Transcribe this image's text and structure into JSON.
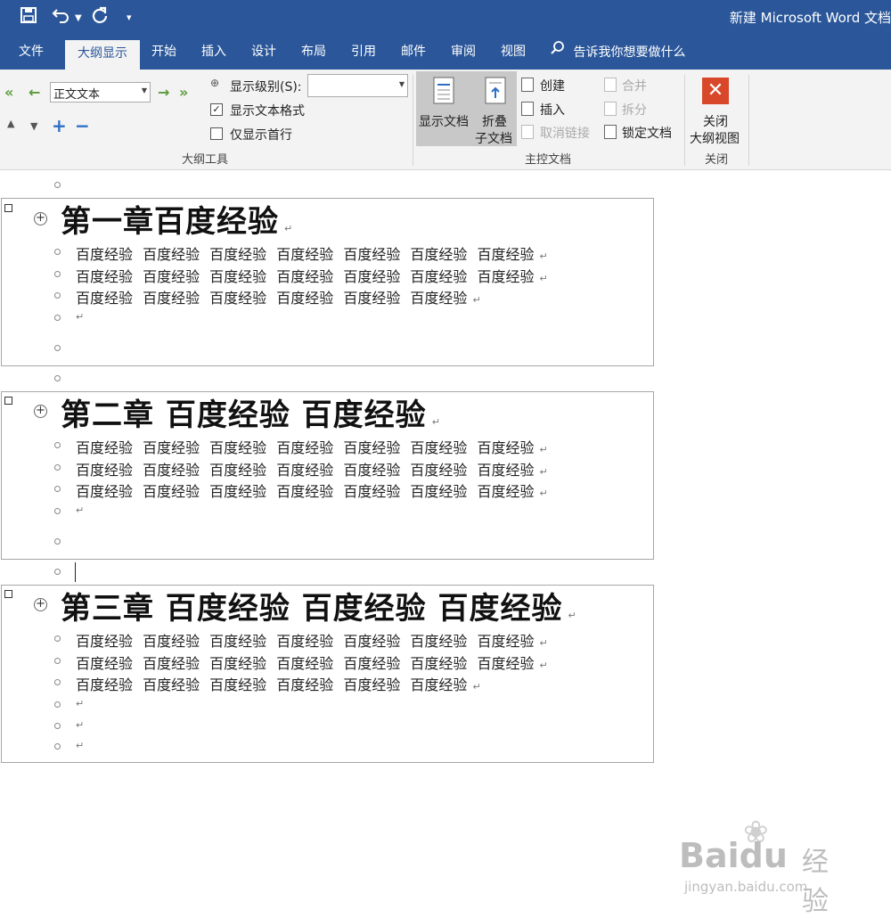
{
  "titlebar": {
    "doc_title": "新建 Microsoft Word 文档",
    "icons": [
      "save-icon",
      "undo-icon",
      "redo-icon",
      "customize-qat-icon"
    ]
  },
  "tabs": [
    {
      "label": "文件",
      "active": false
    },
    {
      "label": "大纲显示",
      "active": true
    },
    {
      "label": "开始",
      "active": false
    },
    {
      "label": "插入",
      "active": false
    },
    {
      "label": "设计",
      "active": false
    },
    {
      "label": "布局",
      "active": false
    },
    {
      "label": "引用",
      "active": false
    },
    {
      "label": "邮件",
      "active": false
    },
    {
      "label": "审阅",
      "active": false
    },
    {
      "label": "视图",
      "active": false
    }
  ],
  "tell_me": "告诉我你想要做什么",
  "ribbon": {
    "outline_tools": {
      "level_select": "正文文本",
      "show_level_label": "显示级别(S):",
      "show_level_value": "",
      "show_text_format": "显示文本格式",
      "show_text_format_checked": true,
      "first_line_only": "仅显示首行",
      "first_line_only_checked": false,
      "group_label": "大纲工具"
    },
    "master_document": {
      "show_document": "显示文档",
      "collapse_line1": "折叠",
      "collapse_line2": "子文档",
      "create": "创建",
      "insert": "插入",
      "unlink": "取消链接",
      "merge": "合并",
      "split": "拆分",
      "lock_document": "锁定文档",
      "group_label": "主控文档"
    },
    "close": {
      "line1": "关闭",
      "line2": "大纲视图",
      "group_label": "关闭"
    }
  },
  "document": {
    "chapters": [
      {
        "heading": "第一章百度经验",
        "lines": [
          "百度经验 百度经验 百度经验 百度经验 百度经验 百度经验 百度经验",
          "百度经验 百度经验 百度经验 百度经验 百度经验 百度经验 百度经验",
          "百度经验 百度经验 百度经验 百度经验 百度经验 百度经验"
        ]
      },
      {
        "heading": "第二章 百度经验 百度经验",
        "lines": [
          "百度经验 百度经验 百度经验 百度经验 百度经验 百度经验 百度经验",
          "百度经验 百度经验 百度经验 百度经验 百度经验 百度经验 百度经验",
          "百度经验 百度经验 百度经验 百度经验 百度经验 百度经验 百度经验"
        ]
      },
      {
        "heading": "第三章 百度经验 百度经验 百度经验",
        "lines": [
          "百度经验 百度经验 百度经验 百度经验 百度经验 百度经验 百度经验",
          "百度经验 百度经验 百度经验 百度经验 百度经验 百度经验 百度经验",
          "百度经验 百度经验 百度经验 百度经验 百度经验 百度经验"
        ]
      }
    ],
    "paragraph_mark": "↵"
  },
  "watermark": {
    "brand": "Baidu",
    "suffix": "经验",
    "url": "jingyan.baidu.com"
  }
}
